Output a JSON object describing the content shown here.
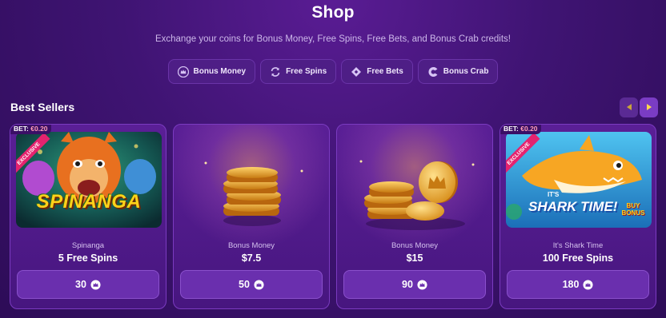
{
  "header": {
    "title": "Shop",
    "subtitle": "Exchange your coins for Bonus Money, Free Spins, Free Bets, and Bonus Crab credits!"
  },
  "tabs": [
    {
      "label": "Bonus Money",
      "icon": "crown-icon"
    },
    {
      "label": "Free Spins",
      "icon": "refresh-icon"
    },
    {
      "label": "Free Bets",
      "icon": "ticket-icon"
    },
    {
      "label": "Bonus Crab",
      "icon": "crab-claw-icon"
    }
  ],
  "section": {
    "title": "Best Sellers"
  },
  "cards": [
    {
      "bet_label": "BET:",
      "bet_value": "€0.20",
      "badge": "EXCLUSIVE",
      "game_title": "SPINANGA",
      "sub": "Spinanga",
      "name": "5 Free Spins",
      "price": "30"
    },
    {
      "sub": "Bonus Money",
      "name": "$7.5",
      "price": "50"
    },
    {
      "sub": "Bonus Money",
      "name": "$15",
      "price": "90"
    },
    {
      "bet_label": "BET:",
      "bet_value": "€0.20",
      "badge": "EXCLUSIVE",
      "game_title": "SHARK TIME!",
      "game_top": "IT'S",
      "game_tag": "BUY BONUS",
      "sub": "It's Shark Time",
      "name": "100 Free Spins",
      "price": "180"
    }
  ],
  "colors": {
    "accent": "#7b3bc0",
    "background": "#3f1473",
    "badge": "#e4236f",
    "coin": "#f2b233"
  }
}
